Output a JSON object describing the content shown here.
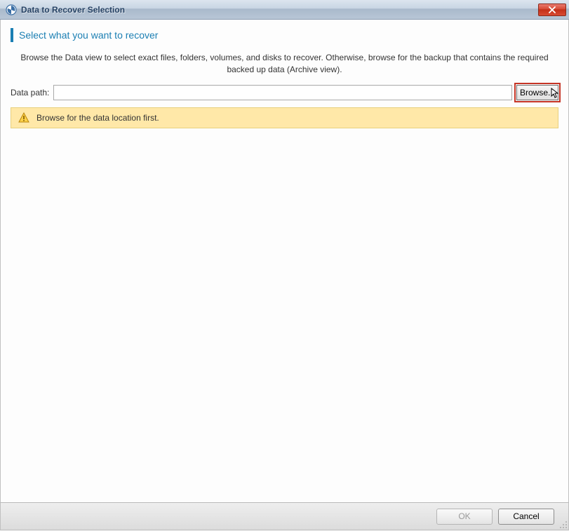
{
  "window": {
    "title": "Data to Recover Selection"
  },
  "heading": "Select what you want to recover",
  "instruction": "Browse the Data view to select exact files, folders, volumes, and disks to recover. Otherwise, browse for the backup that contains the required backed up data (Archive view).",
  "path": {
    "label": "Data path:",
    "value": "",
    "browse_label": "Browse..."
  },
  "warning": {
    "message": "Browse for the data location first."
  },
  "footer": {
    "ok_label": "OK",
    "cancel_label": "Cancel"
  }
}
